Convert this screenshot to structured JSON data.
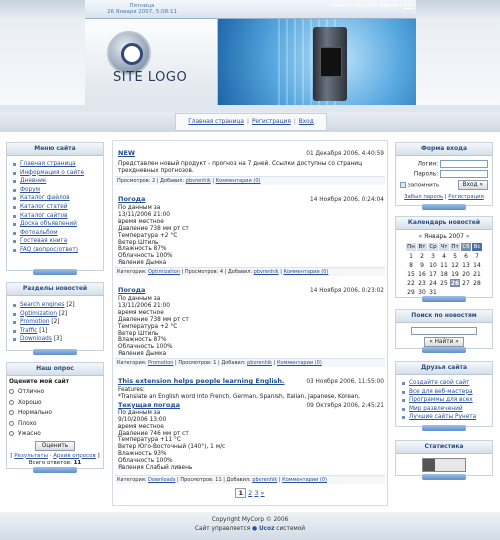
{
  "header": {
    "date_line1": "Пятница",
    "date_line2": "26 Января 2007, 5:08:11",
    "welcome_prefix": "Приветствую Вас",
    "welcome_user": "Гость",
    "separator": "|",
    "rss": "RSS",
    "logo_text": "SITE LOGO"
  },
  "menu": {
    "items": [
      "Главная страница",
      "Регистрация",
      "Вход"
    ],
    "sep": "|"
  },
  "left_menu": {
    "title": "Меню сайта",
    "items": [
      "Главная страница",
      "Информация о сайте",
      "Дневник",
      "Форум",
      "Каталог файлов",
      "Каталог статей",
      "Каталог сайтов",
      "Доска объявлений",
      "Фотоальбом",
      "Гостевая книга",
      "FAQ (вопрос/ответ)"
    ]
  },
  "news_sections": {
    "title": "Разделы новостей",
    "items": [
      {
        "name": "Search engines",
        "count": "[2]"
      },
      {
        "name": "Optimization",
        "count": "[2]"
      },
      {
        "name": "Promotion",
        "count": "[2]"
      },
      {
        "name": "Traffic",
        "count": "[1]"
      },
      {
        "name": "Downloads",
        "count": "[3]"
      }
    ]
  },
  "poll": {
    "title": "Наш опрос",
    "question": "Оцените мой сайт",
    "options": [
      "Отлично",
      "Хорошо",
      "Нормально",
      "Плохо",
      "Ужасно"
    ],
    "vote_button": "Оценить",
    "results_link": "Результаты",
    "archive_link": "Архив опросов",
    "total_label": "Всего ответов:",
    "total_value": "11"
  },
  "news": [
    {
      "title": "NEW",
      "date": "01 Декабря 2006, 4:40:59",
      "body": "Представлен новый продукт - прогноз на 7 дней. Ссылки доступны со страниц трехдневных прогнозов.",
      "meta_views": "Просмотров: 2",
      "meta_added": "Добавил:",
      "meta_author": "pbvrenhik",
      "meta_comments": "Комментарии (0)"
    },
    {
      "title": "Погода",
      "date": "14 Ноября 2006, 0:24:04",
      "body_lines": [
        "По данным за",
        "13/11/2006 21:00",
        "время местное",
        "Давление 738 мм рт ст",
        "Температура +2 °C",
        "Ветер Штиль",
        "Влажность 87%",
        "Облачность 100%",
        "Явления Дымка"
      ],
      "meta_category_label": "Категория:",
      "meta_category": "Optimization",
      "meta_views": "Просмотров: 4",
      "meta_added": "Добавил:",
      "meta_author": "pbvrenhik",
      "meta_comments": "Комментарии (0)"
    },
    {
      "title": "Погода",
      "date": "14 Ноября 2006, 0:23:02",
      "body_lines": [
        "По данным за",
        "13/11/2006 21:00",
        "время местное",
        "Давление 738 мм рт ст",
        "Температура +2 °C",
        "Ветер Штиль",
        "Влажность 87%",
        "Облачность 100%",
        "Явления Дымка"
      ],
      "meta_category_label": "Категория:",
      "meta_category": "Promotion",
      "meta_views": "Просмотров: 1",
      "meta_added": "Добавил:",
      "meta_author": "pbvrenhik",
      "meta_comments": "Комментарии (0)"
    },
    {
      "title": "This extension helps people learning English.",
      "date": "03 Ноября 2006, 11:55:00",
      "body_lines": [
        "Features:",
        "*Translate an English word into French, German, Spanish, Italian, Japanese, Korean,"
      ],
      "subtitle": "Текущая погода",
      "subdate": "09 Октября 2006, 2:45:21",
      "body_lines2": [
        "По данным за",
        "9/10/2006 13:00",
        "время местное",
        "Давление 746 мм рт ст",
        "Температура +11 °C",
        "Ветер Юго-Восточный (140°), 1 м/с",
        "Влажность 93%",
        "Облачность 100%",
        "Явления Слабый ливень"
      ],
      "meta_category_label": "Категория:",
      "meta_category": "Downloads",
      "meta_views": "Просмотров: 11",
      "meta_added": "Добавил:",
      "meta_author": "pbvrenhik",
      "meta_comments": "Комментарии (0)"
    }
  ],
  "pager": {
    "current": "1",
    "pages": [
      "2",
      "3"
    ],
    "next": "»"
  },
  "login": {
    "title": "Форма входа",
    "login_label": "Логин:",
    "password_label": "Пароль:",
    "remember_label": "запомнить",
    "submit": "Вход »",
    "forgot": "Забыл пароль",
    "register": "Регистрация"
  },
  "calendar": {
    "title": "Календарь новостей",
    "prev": "«",
    "month": "Январь 2007",
    "next": "»",
    "days": [
      "Пн",
      "Вт",
      "Ср",
      "Чт",
      "Пт",
      "Сб",
      "Вс"
    ],
    "weeks": [
      [
        "1",
        "2",
        "3",
        "4",
        "5",
        "6",
        "7"
      ],
      [
        "8",
        "9",
        "10",
        "11",
        "12",
        "13",
        "14"
      ],
      [
        "15",
        "16",
        "17",
        "18",
        "19",
        "20",
        "21"
      ],
      [
        "22",
        "23",
        "24",
        "25",
        "26",
        "27",
        "28"
      ],
      [
        "29",
        "30",
        "31",
        "",
        "",
        "",
        ""
      ]
    ],
    "today": "26"
  },
  "search": {
    "title": "Поиск по новостям",
    "button": "« Найти »"
  },
  "friends": {
    "title": "Друзья сайта",
    "items": [
      "Создайте свой сайт",
      "Все для веб-мастера",
      "Программы для всех",
      "Мир развлечений",
      "Лучшие сайты Рунета"
    ]
  },
  "stats": {
    "title": "Статистика"
  },
  "footer": {
    "line1": "Copyright MyCorp © 2006",
    "line2_prefix": "Сайт управляется",
    "line2_brand": "Ucoz",
    "line2_suffix": "системой"
  }
}
